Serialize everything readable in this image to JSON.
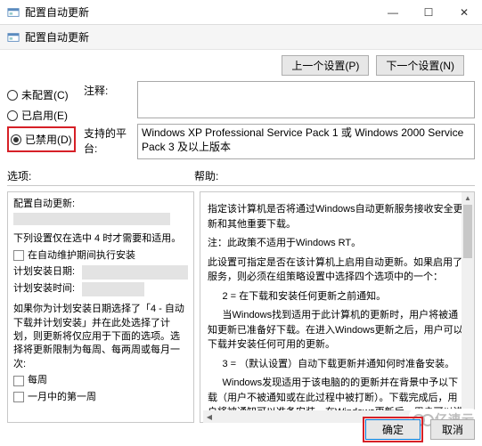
{
  "window": {
    "title": "配置自动更新",
    "subheader": "配置自动更新",
    "close": "✕",
    "max": "☐",
    "min": "—"
  },
  "nav": {
    "prev": "上一个设置(P)",
    "next": "下一个设置(N)"
  },
  "radios": {
    "not_configured": "未配置(C)",
    "enabled": "已启用(E)",
    "disabled": "已禁用(D)"
  },
  "rows": {
    "comment_label": "注释:",
    "comment_value": "",
    "platform_label": "支持的平台:",
    "platform_value": "Windows XP Professional Service Pack 1 或 Windows 2000 Service Pack 3 及以上版本"
  },
  "sections": {
    "options": "选项:",
    "help": "帮助:"
  },
  "options": {
    "heading": "配置自动更新:",
    "note": "下列设置仅在选中 4 时才需要和适用。",
    "maintenance_chk": "在自动维护期间执行安装",
    "sched_day_label": "计划安装日期:",
    "sched_time_label": "计划安装时间:",
    "long_note": "如果你为计划安装日期选择了「4 - 自动下载并计划安装」并在此处选择了计划，则更新将仅应用于下面的选项。选择将更新限制为每周、每两周或每月一次:",
    "chk_weekly": "每周",
    "chk_first_week": "一月中的第一周"
  },
  "help": {
    "p1": "指定该计算机是否将通过Windows自动更新服务接收安全更新和其他重要下载。",
    "p2": "注：此政策不适用于Windows RT。",
    "p3": "此设置可指定是否在该计算机上启用自动更新。如果启用了服务，则必须在组策略设置中选择四个选项中的一个：",
    "p4": "2 = 在下载和安装任何更新之前通知。",
    "p5": "当Windows找到适用于此计算机的更新时，用户将被通知更新已准备好下载。在进入Windows更新之后，用户可以下载并安装任何可用的更新。",
    "p6": "3 = （默认设置）自动下载更新并通知何时准备安装。",
    "p7": "Windows发现适用于该电脑的的更新并在背景中予以下载（用户不被通知或在此过程中被打断）。下载完成后，用户将被通知可以准备安装。在Windows更新后，用户可以进行安装。"
  },
  "buttons": {
    "ok": "确定",
    "cancel": "取消"
  },
  "watermark": "亿速云"
}
